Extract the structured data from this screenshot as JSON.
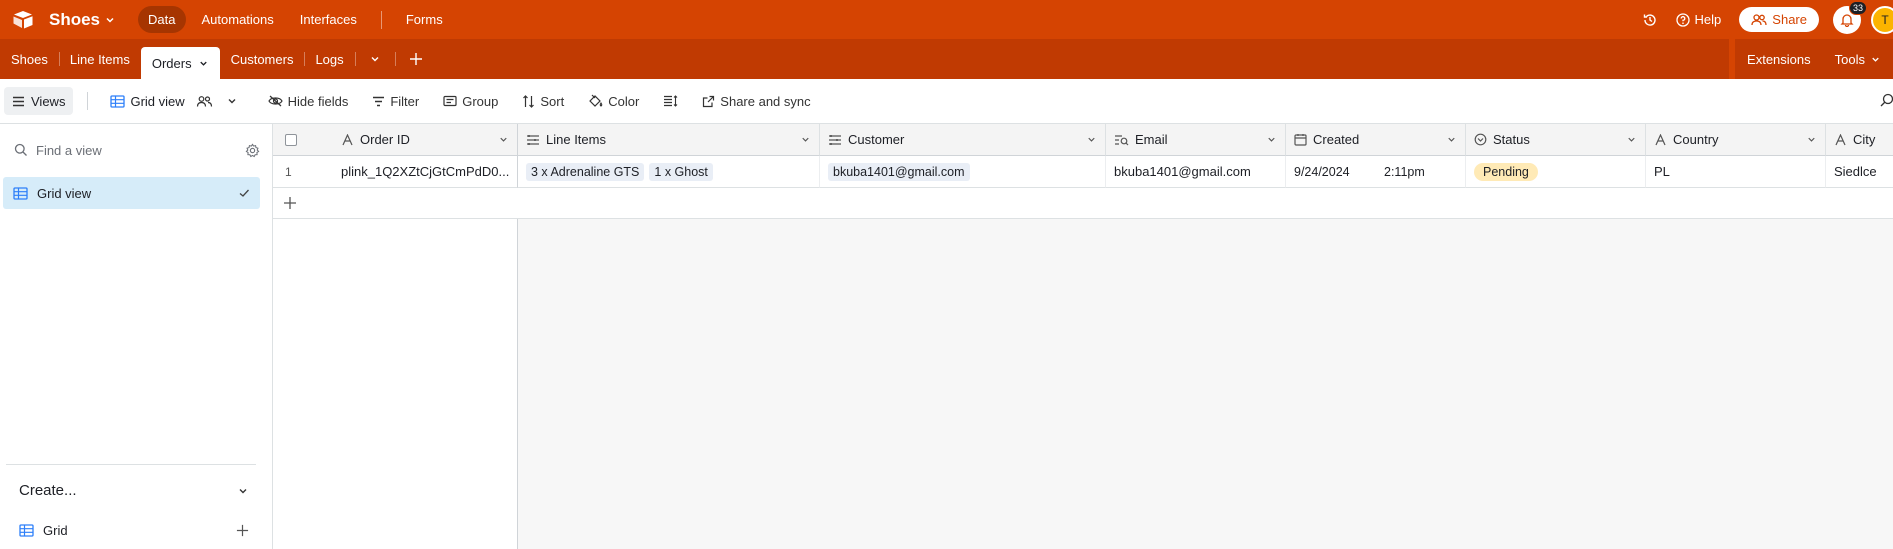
{
  "topbar": {
    "base_name": "Shoes",
    "nav": [
      "Data",
      "Automations",
      "Interfaces",
      "Forms"
    ],
    "help": "Help",
    "share": "Share",
    "notifications_count": "33",
    "avatar_initial": "T",
    "accent": "#d54402"
  },
  "tabbar": {
    "tabs": [
      "Shoes",
      "Line Items",
      "Orders",
      "Customers",
      "Logs"
    ],
    "active_tab": "Orders",
    "extensions": "Extensions",
    "tools": "Tools"
  },
  "toolbar": {
    "views": "Views",
    "grid_view": "Grid view",
    "hide_fields": "Hide fields",
    "filter": "Filter",
    "group": "Group",
    "sort": "Sort",
    "color": "Color",
    "share_sync": "Share and sync"
  },
  "sidebar": {
    "find_placeholder": "Find a view",
    "active_view": "Grid view",
    "create": "Create...",
    "create_grid": "Grid"
  },
  "grid": {
    "columns": [
      "Order ID",
      "Line Items",
      "Customer",
      "Email",
      "Created",
      "Status",
      "Country",
      "City"
    ],
    "rows": [
      {
        "num": "1",
        "order_id": "plink_1Q2XZtCjGtCmPdD0...",
        "line_items": [
          "3 x Adrenaline GTS",
          "1 x Ghost"
        ],
        "customer": "bkuba1401@gmail.com",
        "email": "bkuba1401@gmail.com",
        "created_date": "9/24/2024",
        "created_time": "2:11pm",
        "status": "Pending",
        "country": "PL",
        "city": "Siedlce"
      }
    ]
  }
}
